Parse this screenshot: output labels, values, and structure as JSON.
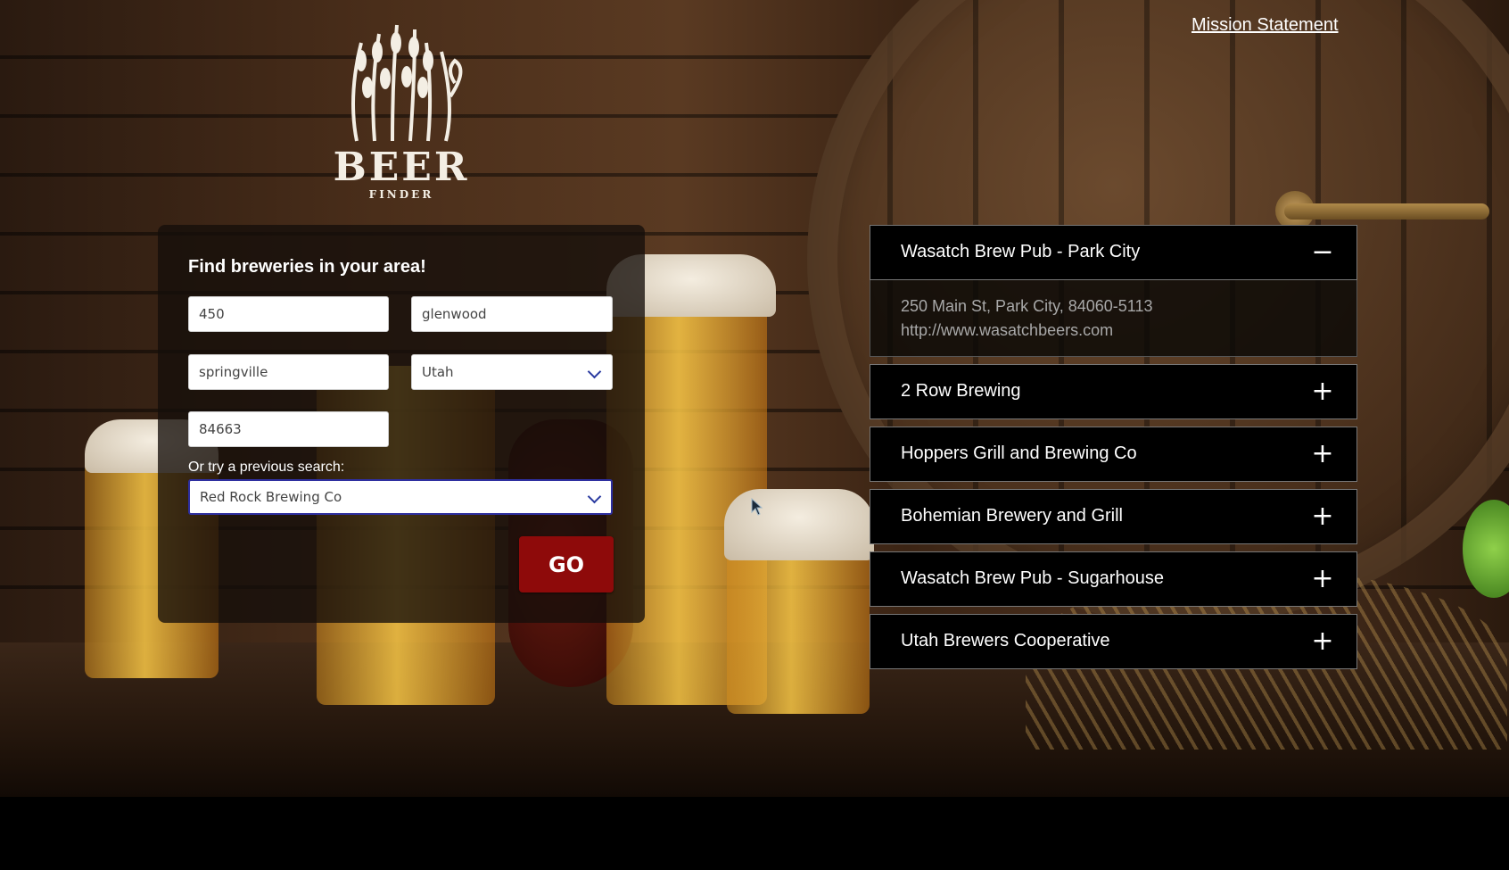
{
  "logo": {
    "brand": "BEER",
    "subtitle": "FINDER"
  },
  "header": {
    "mission_link": "Mission Statement"
  },
  "search": {
    "title": "Find breweries in your area!",
    "street_number": "450",
    "street_name": "glenwood",
    "city": "springville",
    "state": "Utah",
    "zip": "84663",
    "previous_label": "Or try a previous search:",
    "previous_selected": "Red Rock Brewing Co",
    "go_label": "GO"
  },
  "results": [
    {
      "name": "Wasatch Brew Pub - Park City",
      "expanded": true,
      "toggle": "−",
      "address": "250 Main St, Park City, 84060-5113",
      "url": "http://www.wasatchbeers.com"
    },
    {
      "name": "2 Row Brewing",
      "expanded": false,
      "toggle": "+"
    },
    {
      "name": "Hoppers Grill and Brewing Co",
      "expanded": false,
      "toggle": "+"
    },
    {
      "name": "Bohemian Brewery and Grill",
      "expanded": false,
      "toggle": "+"
    },
    {
      "name": "Wasatch Brew Pub - Sugarhouse",
      "expanded": false,
      "toggle": "+"
    },
    {
      "name": "Utah Brewers Cooperative",
      "expanded": false,
      "toggle": "+"
    }
  ],
  "colors": {
    "go_button": "#8e0a0a",
    "accordion_header": "#000000",
    "select_focus": "#2e2fa0"
  }
}
